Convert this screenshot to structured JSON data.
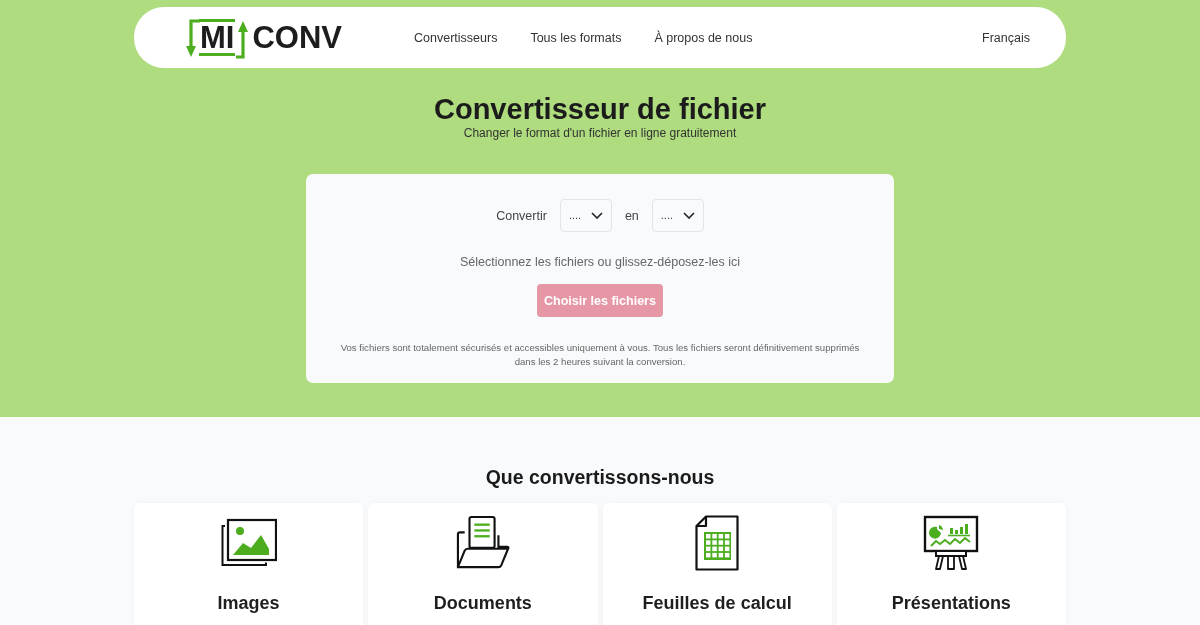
{
  "header": {
    "logo": {
      "part_1": "MI",
      "part_2": "CONV"
    },
    "nav": [
      {
        "label": "Convertisseurs"
      },
      {
        "label": "Tous les formats"
      },
      {
        "label": "À propos de nous"
      }
    ],
    "language": "Français"
  },
  "hero": {
    "title": "Convertisseur de fichier",
    "subtitle": "Changer le format d'un fichier en ligne gratuitement"
  },
  "converter": {
    "from_label": "Convertir",
    "from_select": {
      "value": "...."
    },
    "to_label": "en",
    "to_select": {
      "value": "...."
    },
    "drop_hint": "Sélectionnez les fichiers ou glissez-déposez-les ici",
    "button": {
      "label": "Choisir les fichiers",
      "disabled": true
    },
    "note": "Vos fichiers sont totalement sécurisés et accessibles uniquement à vous. Tous les fichiers seront définitivement supprimés dans les 2 heures suivant la conversion."
  },
  "categories_section": {
    "title": "Que convertissons-nous",
    "items": [
      {
        "kind": "images",
        "label": "Images"
      },
      {
        "kind": "documents",
        "label": "Documents"
      },
      {
        "kind": "spreadsheets",
        "label": "Feuilles de calcul"
      },
      {
        "kind": "presentations",
        "label": "Présentations"
      }
    ]
  }
}
